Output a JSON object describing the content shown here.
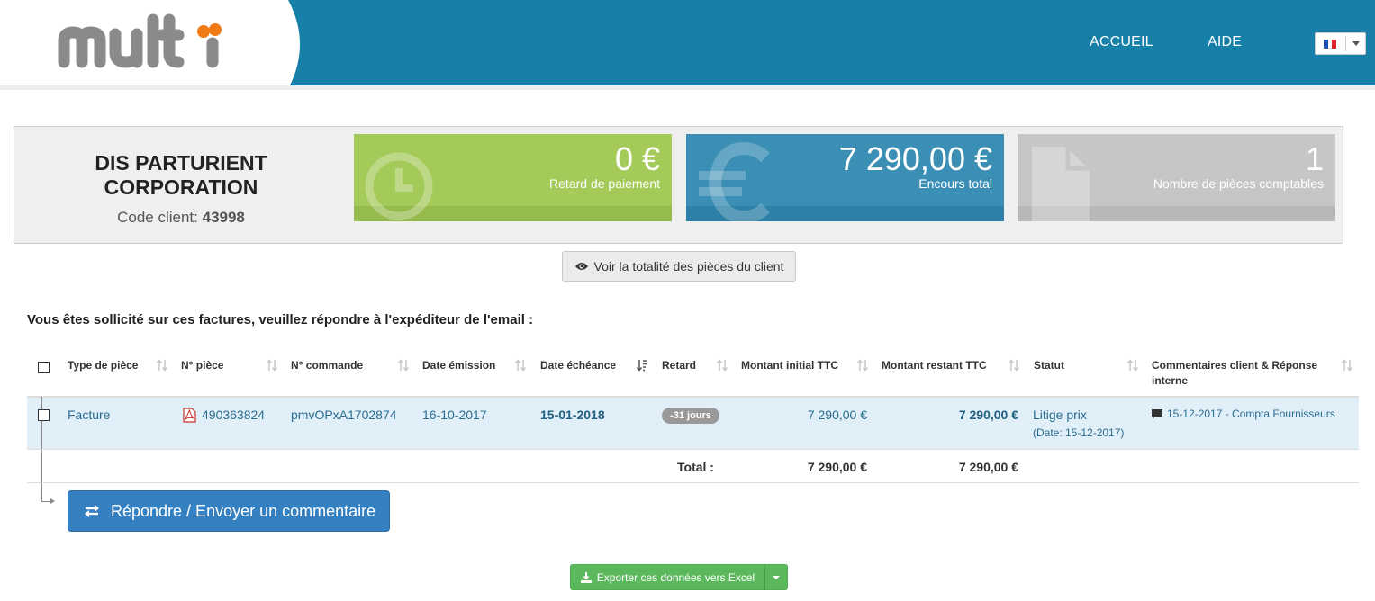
{
  "header": {
    "logo_text": "multi",
    "nav": [
      {
        "label": "ACCUEIL"
      },
      {
        "label": "AIDE"
      }
    ],
    "language": "fr"
  },
  "client": {
    "name_line1": "DIS PARTURIENT",
    "name_line2": "CORPORATION",
    "code_label": "Code client:",
    "code_value": "43998"
  },
  "tiles": [
    {
      "value": "0 €",
      "label": "Retard de paiement",
      "icon": "clock-icon",
      "color": "#a4cb5a"
    },
    {
      "value": "7 290,00 €",
      "label": "Encours total",
      "icon": "euro-icon",
      "color": "#3b8fb5"
    },
    {
      "value": "1",
      "label": "Nombre de pièces comptables",
      "icon": "document-icon",
      "color": "#c6c6c6"
    }
  ],
  "view_all_button": "Voir la totalité des pièces du client",
  "notice": "Vous êtes sollicité sur ces factures, veuillez répondre à l'expéditeur de l'email :",
  "table": {
    "columns": [
      "Type de pièce",
      "N° pièce",
      "N° commande",
      "Date émission",
      "Date échéance",
      "Retard",
      "Montant initial TTC",
      "Montant restant TTC",
      "Statut",
      "Commentaires client & Réponse",
      "interne"
    ],
    "rows": [
      {
        "type": "Facture",
        "piece": "490363824",
        "commande": "pmvOPxA1702874",
        "date_emission": "16-10-2017",
        "date_echeance": "15-01-2018",
        "retard": "-31 jours",
        "montant_initial": "7 290,00 €",
        "montant_restant": "7 290,00 €",
        "statut": "Litige prix",
        "statut_date": "(Date: 15-12-2017)",
        "commentaire": "15-12-2017 - Compta Fournisseurs"
      }
    ],
    "total_label": "Total :",
    "total_initial": "7 290,00 €",
    "total_restant": "7 290,00 €"
  },
  "reply_button": "Répondre / Envoyer un commentaire",
  "export_button": "Exporter ces données vers Excel",
  "colors": {
    "header_blue": "#1780a8",
    "button_blue": "#3480c0",
    "export_green": "#5cb85c"
  }
}
